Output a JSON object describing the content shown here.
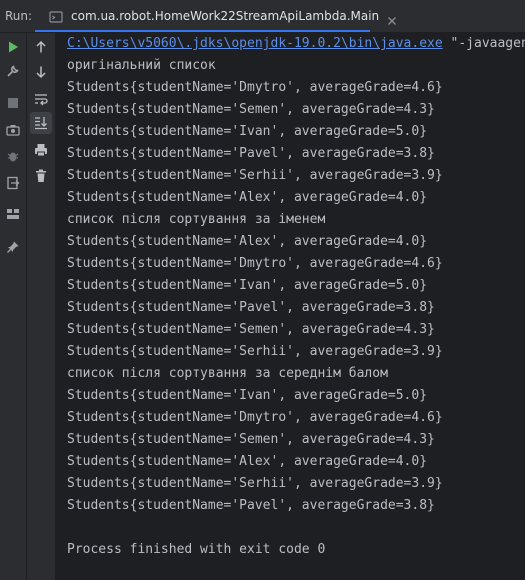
{
  "run_label": "Run:",
  "tab": {
    "title": "com.ua.robot.HomeWork22StreamApiLambda.Main"
  },
  "colors": {
    "accent": "#3574f0",
    "run_green": "#5fb865",
    "link": "#5c8ee8",
    "text": "#bcbec4",
    "console_bg": "#1e1f22"
  },
  "toolbar_left": [
    {
      "name": "run-icon"
    },
    {
      "name": "wrench-icon"
    },
    {
      "name": "stop-icon"
    },
    {
      "name": "camera-icon"
    },
    {
      "name": "debug-bug-icon"
    },
    {
      "name": "exit-icon"
    },
    {
      "name": "layout-icon"
    },
    {
      "name": "pin-icon"
    }
  ],
  "toolbar_right": [
    {
      "name": "arrow-up-icon"
    },
    {
      "name": "arrow-down-icon"
    },
    {
      "name": "soft-wrap-icon"
    },
    {
      "name": "scroll-to-end-icon"
    },
    {
      "name": "print-icon"
    },
    {
      "name": "trash-icon"
    }
  ],
  "console": {
    "command_path": "C:\\Users\\v5060\\.jdks\\openjdk-19.0.2\\bin\\java.exe",
    "command_rest": " \"-javaagent:",
    "lines": [
      "оригінальний список",
      "Students{studentName='Dmytro', averageGrade=4.6}",
      "Students{studentName='Semen', averageGrade=4.3}",
      "Students{studentName='Ivan', averageGrade=5.0}",
      "Students{studentName='Pavel', averageGrade=3.8}",
      "Students{studentName='Serhii', averageGrade=3.9}",
      "Students{studentName='Alex', averageGrade=4.0}",
      "список після сортування за іменем",
      "Students{studentName='Alex', averageGrade=4.0}",
      "Students{studentName='Dmytro', averageGrade=4.6}",
      "Students{studentName='Ivan', averageGrade=5.0}",
      "Students{studentName='Pavel', averageGrade=3.8}",
      "Students{studentName='Semen', averageGrade=4.3}",
      "Students{studentName='Serhii', averageGrade=3.9}",
      "список після сортування за середнім балом",
      "Students{studentName='Ivan', averageGrade=5.0}",
      "Students{studentName='Dmytro', averageGrade=4.6}",
      "Students{studentName='Semen', averageGrade=4.3}",
      "Students{studentName='Alex', averageGrade=4.0}",
      "Students{studentName='Serhii', averageGrade=3.9}",
      "Students{studentName='Pavel', averageGrade=3.8}",
      "",
      "Process finished with exit code 0"
    ]
  }
}
